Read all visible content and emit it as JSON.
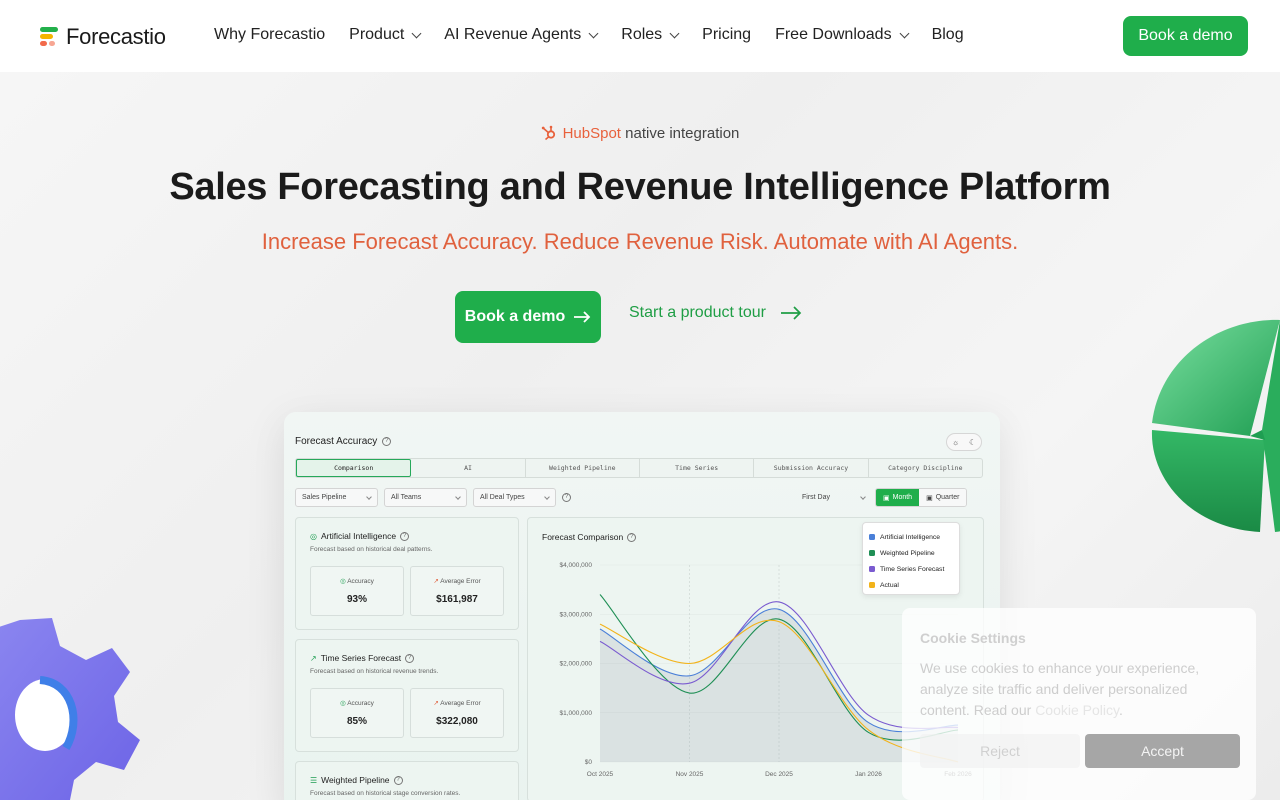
{
  "brand": {
    "name": "Forecastio"
  },
  "nav": {
    "items": [
      {
        "label": "Why Forecastio",
        "dropdown": false
      },
      {
        "label": "Product",
        "dropdown": true
      },
      {
        "label": "AI Revenue Agents",
        "dropdown": true
      },
      {
        "label": "Roles",
        "dropdown": true
      },
      {
        "label": "Pricing",
        "dropdown": false
      },
      {
        "label": "Free Downloads",
        "dropdown": true
      },
      {
        "label": "Blog",
        "dropdown": false
      }
    ],
    "cta": "Book a demo"
  },
  "hero": {
    "integration_brand": "HubSpot",
    "integration_text": "native integration",
    "title": "Sales Forecasting and Revenue Intelligence Platform",
    "subtitle": "Increase Forecast Accuracy. Reduce Revenue Risk. Automate with AI Agents.",
    "primary_cta": "Book a demo",
    "secondary_cta": "Start a product tour"
  },
  "dashboard": {
    "title": "Forecast Accuracy",
    "tabs": [
      "Comparison",
      "AI",
      "Weighted Pipeline",
      "Time Series",
      "Submission Accuracy",
      "Category Discipline"
    ],
    "active_tab": "Comparison",
    "filters": [
      "Sales Pipeline",
      "All Teams",
      "All Deal Types"
    ],
    "period_select": "First Day",
    "period_options": [
      "Month",
      "Quarter"
    ],
    "active_period": "Month",
    "cards": [
      {
        "title": "Artificial Intelligence",
        "desc": "Forecast based on historical deal patterns.",
        "accuracy_label": "Accuracy",
        "accuracy": "93%",
        "error_label": "Average Error",
        "error": "$161,987"
      },
      {
        "title": "Time Series Forecast",
        "desc": "Forecast based on historical revenue trends.",
        "accuracy_label": "Accuracy",
        "accuracy": "85%",
        "error_label": "Average Error",
        "error": "$322,080"
      },
      {
        "title": "Weighted Pipeline",
        "desc": "Forecast based on historical stage conversion rates."
      }
    ],
    "chart_title": "Forecast Comparison"
  },
  "chart_data": {
    "type": "line",
    "title": "Forecast Comparison",
    "x": [
      "Oct 2025",
      "Nov 2025",
      "Dec 2025",
      "Jan 2026",
      "Feb 2026"
    ],
    "y_ticks": [
      "$4,000,000",
      "$3,000,000",
      "$2,000,000",
      "$1,000,000",
      "$0"
    ],
    "ylim": [
      0,
      4000000
    ],
    "series": [
      {
        "name": "Artificial Intelligence",
        "color": "#4a7fd8",
        "values": [
          2700000,
          1750000,
          3100000,
          800000,
          750000
        ]
      },
      {
        "name": "Weighted Pipeline",
        "color": "#1f8f55",
        "values": [
          3400000,
          1400000,
          2900000,
          600000,
          650000
        ]
      },
      {
        "name": "Time Series Forecast",
        "color": "#7a5bd0",
        "values": [
          2450000,
          1600000,
          3250000,
          950000,
          700000
        ]
      },
      {
        "name": "Actual",
        "color": "#f2b31a",
        "values": [
          2800000,
          2000000,
          2850000,
          650000,
          0
        ]
      }
    ],
    "legend": "top-right",
    "grid": true
  },
  "cookie": {
    "title": "Cookie Settings",
    "text_before": "We use cookies to enhance your experience, analyze site traffic and deliver personalized content. Read our",
    "link": "Cookie Policy",
    "text_after": ".",
    "reject": "Reject",
    "accept": "Accept"
  }
}
